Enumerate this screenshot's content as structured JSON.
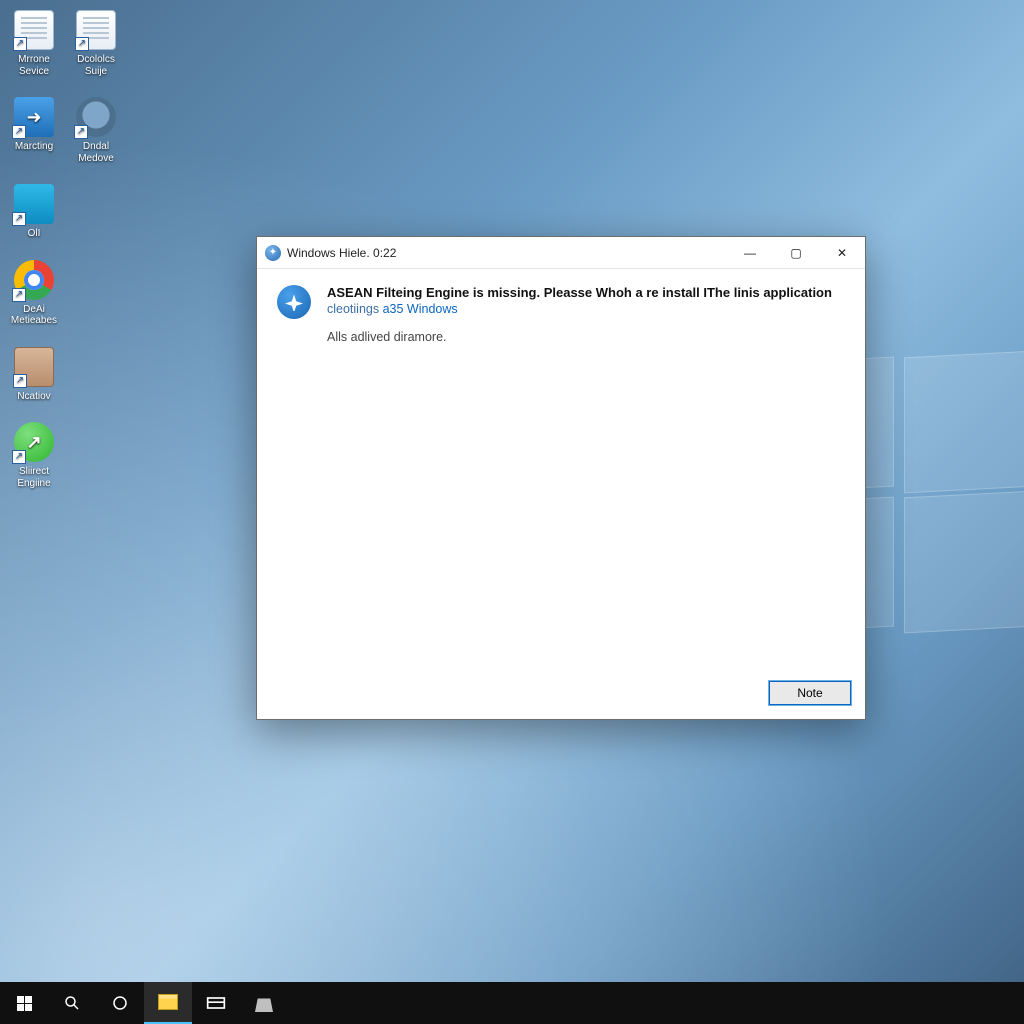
{
  "desktop": {
    "icons": [
      {
        "label": "Mrrone Sevice",
        "glyph": "page"
      },
      {
        "label": "Dcololcs Suije",
        "glyph": "page"
      },
      {
        "label": "Marcting",
        "glyph": "blue"
      },
      {
        "label": "Dndal Medove",
        "glyph": "disc"
      },
      {
        "label": "OlI",
        "glyph": "box"
      },
      {
        "label": "",
        "glyph": ""
      },
      {
        "label": "DeAi Metieabes",
        "glyph": "chrome"
      },
      {
        "label": "",
        "glyph": ""
      },
      {
        "label": "Ncatiov",
        "glyph": "face"
      },
      {
        "label": "",
        "glyph": ""
      },
      {
        "label": "Sliirect Engiine",
        "glyph": "green"
      }
    ]
  },
  "dialog": {
    "title": "Windows Hiele. 0:22",
    "headline": "ASEAN Filteing Engine is missing. Pleasse Whoh a re install IThe linis application",
    "subline_prefix": "cleotiings ",
    "subline_link": "a35 Windows",
    "detail": "Alls adlived diramore.",
    "button": "Note",
    "winbtns": {
      "min": "—",
      "max": "▢",
      "close": "✕"
    }
  },
  "taskbar": {
    "items": [
      {
        "name": "start"
      },
      {
        "name": "search"
      },
      {
        "name": "cortana"
      },
      {
        "name": "file-explorer",
        "active": true
      },
      {
        "name": "task-view"
      },
      {
        "name": "store"
      }
    ]
  }
}
